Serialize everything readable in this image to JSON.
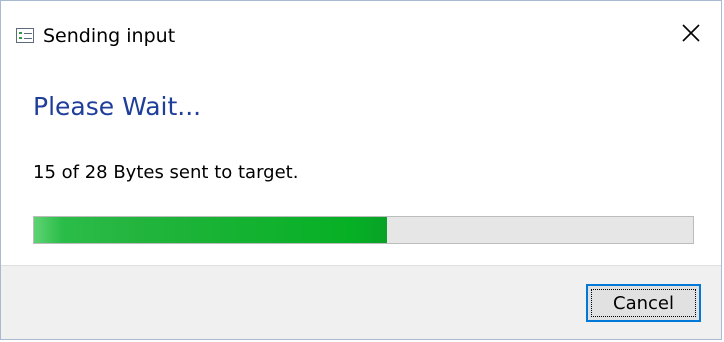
{
  "window": {
    "title": "Sending input",
    "icon": "form-window-icon",
    "close_icon": "close-icon"
  },
  "content": {
    "heading": "Please Wait...",
    "message": "15 of 28 Bytes sent to target.",
    "progress": {
      "value": 15,
      "max": 28,
      "fraction": 0.536,
      "color": "#06b025"
    }
  },
  "footer": {
    "cancel_label": "Cancel"
  },
  "colors": {
    "heading": "#1f3e9a",
    "focus_border": "#0078d7",
    "footer_bg": "#f0f0f0",
    "track_bg": "#e6e6e6"
  }
}
